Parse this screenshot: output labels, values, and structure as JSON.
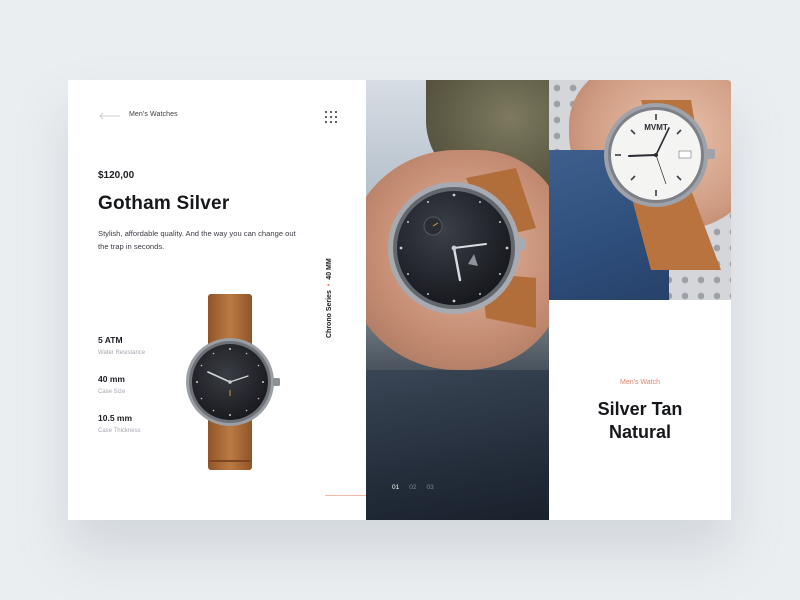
{
  "header": {
    "breadcrumb": "Men's Watches",
    "back_icon": "arrow-left-icon",
    "menu_icon": "grid-menu-icon"
  },
  "product": {
    "price": "$120,00",
    "name": "Gotham Silver",
    "description": "Stylish, affordable quality. And the way you can change out the trap in seconds."
  },
  "specs": [
    {
      "value": "5 ATM",
      "label": "Water Resistance"
    },
    {
      "value": "40 mm",
      "label": "Case Size"
    },
    {
      "value": "10.5 mm",
      "label": "Case Thickness"
    }
  ],
  "series": {
    "name": "Chrono Series",
    "separator": "•",
    "size": "40 MM"
  },
  "pager": {
    "pages": [
      "01",
      "02",
      "03"
    ],
    "active_index": 0
  },
  "featured": {
    "category": "Men's Watch",
    "name_line1": "Silver Tan",
    "name_line2": "Natural",
    "dial_brand": "MVMT"
  },
  "colors": {
    "accent": "#e0826b",
    "background": "#ebeef1",
    "strap_tan": "#b8733e",
    "dark_dial": "#1d1f24"
  }
}
